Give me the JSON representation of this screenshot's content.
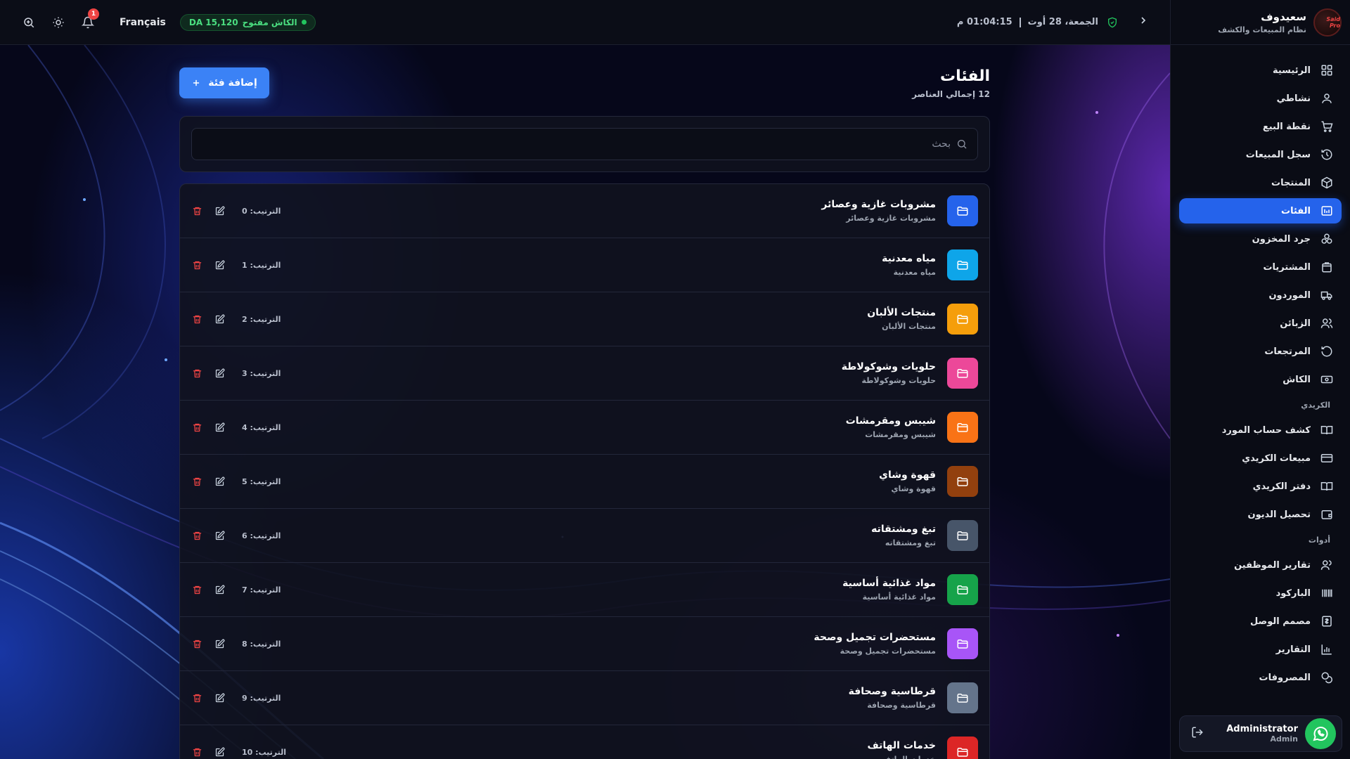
{
  "topbar": {
    "language": "Français",
    "cash_status": "الكاش مفتوح",
    "cash_amount": "DA 15,120",
    "notifications_count": "1",
    "date": "الجمعة، 28 أوت",
    "time": "01:04:15 م"
  },
  "brand": {
    "name": "سعيدوف",
    "subtitle": "نظام المبيعات والكشف",
    "logo_text": "Said Pro"
  },
  "sidebar": {
    "items": [
      {
        "label": "الرئيسية",
        "icon": "dashboard-icon"
      },
      {
        "label": "نشاطي",
        "icon": "user-icon"
      },
      {
        "label": "نقطة البيع",
        "icon": "cart-icon"
      },
      {
        "label": "سجل المبيعات",
        "icon": "history-icon"
      },
      {
        "label": "المنتجات",
        "icon": "box-icon"
      },
      {
        "label": "الفئات",
        "icon": "folder-grid-icon",
        "active": true
      },
      {
        "label": "جرد المخزون",
        "icon": "boxes-icon"
      },
      {
        "label": "المشتريات",
        "icon": "bag-icon"
      },
      {
        "label": "الموردون",
        "icon": "truck-icon"
      },
      {
        "label": "الزبائن",
        "icon": "users-icon"
      },
      {
        "label": "المرتجعات",
        "icon": "rotate-icon"
      },
      {
        "label": "الكاش",
        "icon": "cash-icon"
      }
    ],
    "section_credit": "الكريدي",
    "credit_items": [
      {
        "label": "كشف حساب المورد",
        "icon": "book-open-icon"
      },
      {
        "label": "مبيعات الكريدي",
        "icon": "credit-card-icon"
      },
      {
        "label": "دفتر الكريدي",
        "icon": "book-icon"
      },
      {
        "label": "تحصيل الديون",
        "icon": "wallet-icon"
      }
    ],
    "section_tools": "أدوات",
    "tools_items": [
      {
        "label": "تقارير الموظفين",
        "icon": "users-icon"
      },
      {
        "label": "الباركود",
        "icon": "barcode-icon"
      },
      {
        "label": "مصمم الوصل",
        "icon": "receipt-icon"
      },
      {
        "label": "التقارير",
        "icon": "chart-icon"
      },
      {
        "label": "المصروفات",
        "icon": "coins-icon"
      }
    ],
    "user": {
      "name": "Administrator",
      "role": "Admin"
    }
  },
  "page": {
    "title": "الفئات",
    "count": "12 إجمالي العناصر",
    "add_button": "إضافة فئة",
    "search_placeholder": "بحث"
  },
  "categories": [
    {
      "name": "مشروبات غازية وعصائر",
      "desc": "مشروبات غازية وعصائر",
      "order": "الترتيب: 0",
      "color": "#2563eb"
    },
    {
      "name": "مياه معدنية",
      "desc": "مياه معدنية",
      "order": "الترتيب: 1",
      "color": "#0ea5e9"
    },
    {
      "name": "منتجات الألبان",
      "desc": "منتجات الألبان",
      "order": "الترتيب: 2",
      "color": "#f59e0b"
    },
    {
      "name": "حلويات وشوكولاطة",
      "desc": "حلويات وشوكولاطة",
      "order": "الترتيب: 3",
      "color": "#ec4899"
    },
    {
      "name": "شيبس ومقرمشات",
      "desc": "شيبس ومقرمشات",
      "order": "الترتيب: 4",
      "color": "#f97316"
    },
    {
      "name": "قهوة وشاي",
      "desc": "قهوة وشاي",
      "order": "الترتيب: 5",
      "color": "#92400e"
    },
    {
      "name": "تبغ ومشتقاته",
      "desc": "تبغ ومشتقاته",
      "order": "الترتيب: 6",
      "color": "#475569"
    },
    {
      "name": "مواد غذائية أساسية",
      "desc": "مواد غذائية أساسية",
      "order": "الترتيب: 7",
      "color": "#16a34a"
    },
    {
      "name": "مستحضرات تجميل وصحة",
      "desc": "مستحضرات تجميل وصحة",
      "order": "الترتيب: 8",
      "color": "#a855f7"
    },
    {
      "name": "قرطاسية وصحافة",
      "desc": "قرطاسية وصحافة",
      "order": "الترتيب: 9",
      "color": "#64748b"
    },
    {
      "name": "خدمات الهاتف",
      "desc": "خدمات الهاتف",
      "order": "الترتيب: 10",
      "color": "#dc2626"
    }
  ]
}
